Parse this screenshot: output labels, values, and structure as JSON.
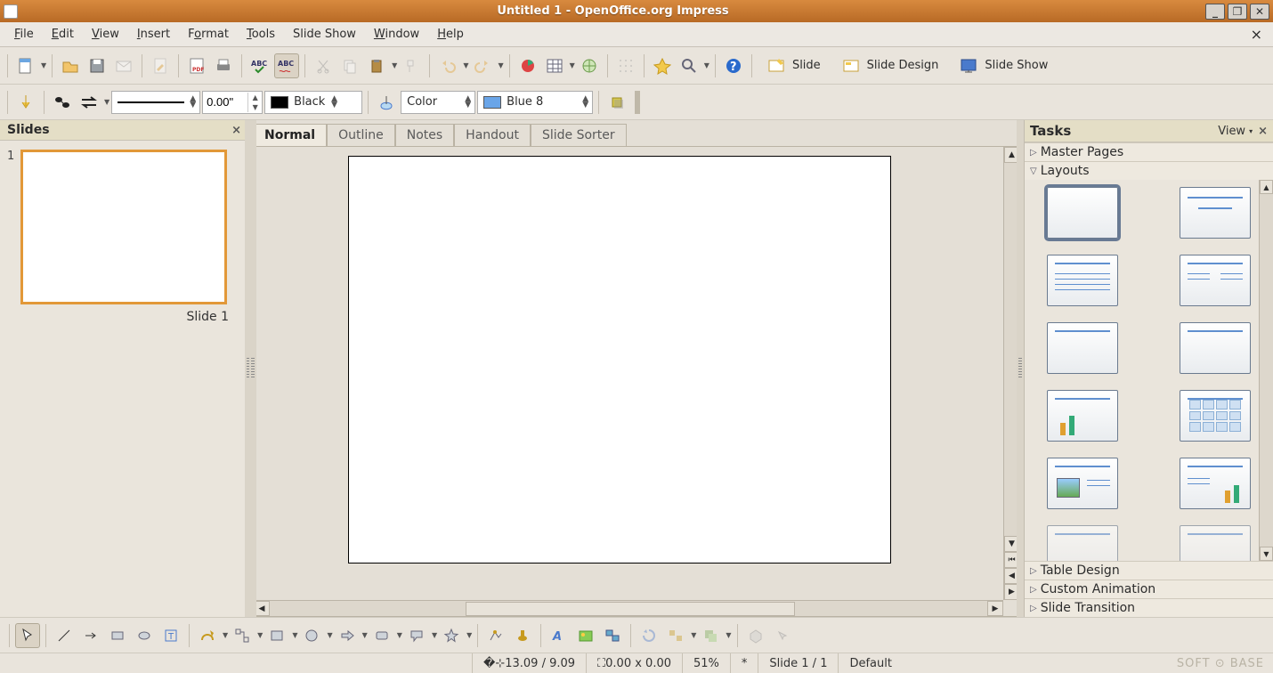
{
  "titlebar": {
    "title": "Untitled 1 - OpenOffice.org Impress"
  },
  "menu": {
    "file": "File",
    "edit": "Edit",
    "view": "View",
    "insert": "Insert",
    "format": "Format",
    "tools": "Tools",
    "slideshow": "Slide Show",
    "window": "Window",
    "help": "Help"
  },
  "toolbar1": {
    "slide": "Slide",
    "slide_design": "Slide Design",
    "slide_show": "Slide Show"
  },
  "toolbar2": {
    "line_width": "0.00\"",
    "line_color_label": "Black",
    "fill_type": "Color",
    "fill_color": "Blue 8"
  },
  "slides_panel": {
    "title": "Slides",
    "slide_number": "1",
    "slide_caption": "Slide 1"
  },
  "view_tabs": {
    "normal": "Normal",
    "outline": "Outline",
    "notes": "Notes",
    "handout": "Handout",
    "sorter": "Slide Sorter"
  },
  "tasks_panel": {
    "title": "Tasks",
    "view": "View",
    "master_pages": "Master Pages",
    "layouts": "Layouts",
    "table_design": "Table Design",
    "custom_animation": "Custom Animation",
    "slide_transition": "Slide Transition"
  },
  "statusbar": {
    "pos": "13.09 / 9.09",
    "size": "0.00 x 0.00",
    "zoom": "51%",
    "modified": "*",
    "slide": "Slide 1 / 1",
    "template": "Default",
    "watermark": "SOFT ⊙ BASE"
  }
}
